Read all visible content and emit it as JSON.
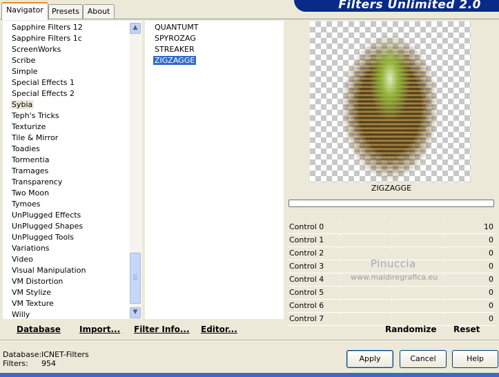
{
  "tabs": [
    {
      "label": "Navigator",
      "active": true
    },
    {
      "label": "Presets",
      "active": false
    },
    {
      "label": "About",
      "active": false
    }
  ],
  "banner_title": "Filters Unlimited 2.0",
  "categories": [
    {
      "label": "Sapphire Filters 12"
    },
    {
      "label": "Sapphire Filters 1c"
    },
    {
      "label": "ScreenWorks"
    },
    {
      "label": "Scribe"
    },
    {
      "label": "Simple"
    },
    {
      "label": "Special Effects 1"
    },
    {
      "label": "Special Effects 2"
    },
    {
      "label": "Sybia",
      "selected": true
    },
    {
      "label": "Teph's Tricks"
    },
    {
      "label": "Texturize"
    },
    {
      "label": "Tile & Mirror"
    },
    {
      "label": "Toadies"
    },
    {
      "label": "Tormentia"
    },
    {
      "label": "Tramages"
    },
    {
      "label": "Transparency"
    },
    {
      "label": "Two Moon"
    },
    {
      "label": "Tymoes"
    },
    {
      "label": "UnPlugged Effects"
    },
    {
      "label": "UnPlugged Shapes"
    },
    {
      "label": "UnPlugged Tools"
    },
    {
      "label": "Variations"
    },
    {
      "label": "Video"
    },
    {
      "label": "Visual Manipulation"
    },
    {
      "label": "VM Distortion"
    },
    {
      "label": "VM Stylize"
    },
    {
      "label": "VM Texture"
    },
    {
      "label": "Willy"
    }
  ],
  "filters": [
    {
      "label": "QUANTUMT"
    },
    {
      "label": "SPYROZAG"
    },
    {
      "label": "STREAKER"
    },
    {
      "label": "ZIGZAGGE",
      "selected": true
    }
  ],
  "preview": {
    "filter_name": "ZIGZAGGE",
    "watermark": "Pinuccia",
    "watermark_url": "www.maidiregrafica.eu"
  },
  "controls": [
    {
      "name": "Control 0",
      "value": "10"
    },
    {
      "name": "Control 1",
      "value": "0"
    },
    {
      "name": "Control 2",
      "value": "0"
    },
    {
      "name": "Control 3",
      "value": "0"
    },
    {
      "name": "Control 4",
      "value": "0"
    },
    {
      "name": "Control 5",
      "value": "0"
    },
    {
      "name": "Control 6",
      "value": "0"
    },
    {
      "name": "Control 7",
      "value": "0"
    }
  ],
  "left_buttons": {
    "database": "Database",
    "import": "Import...",
    "filter_info": "Filter Info...",
    "editor": "Editor..."
  },
  "right_buttons": {
    "randomize": "Randomize",
    "reset": "Reset"
  },
  "status": {
    "database_label": "Database:",
    "database_value": "ICNET-Filters",
    "filters_label": "Filters:",
    "filters_value": "954"
  },
  "dialog_buttons": {
    "apply": "Apply",
    "cancel": "Cancel",
    "help": "Help"
  },
  "colors": {
    "selection": "#316ac5",
    "banner": "#0a2a8a",
    "dialog_bg": "#ece9d8"
  }
}
